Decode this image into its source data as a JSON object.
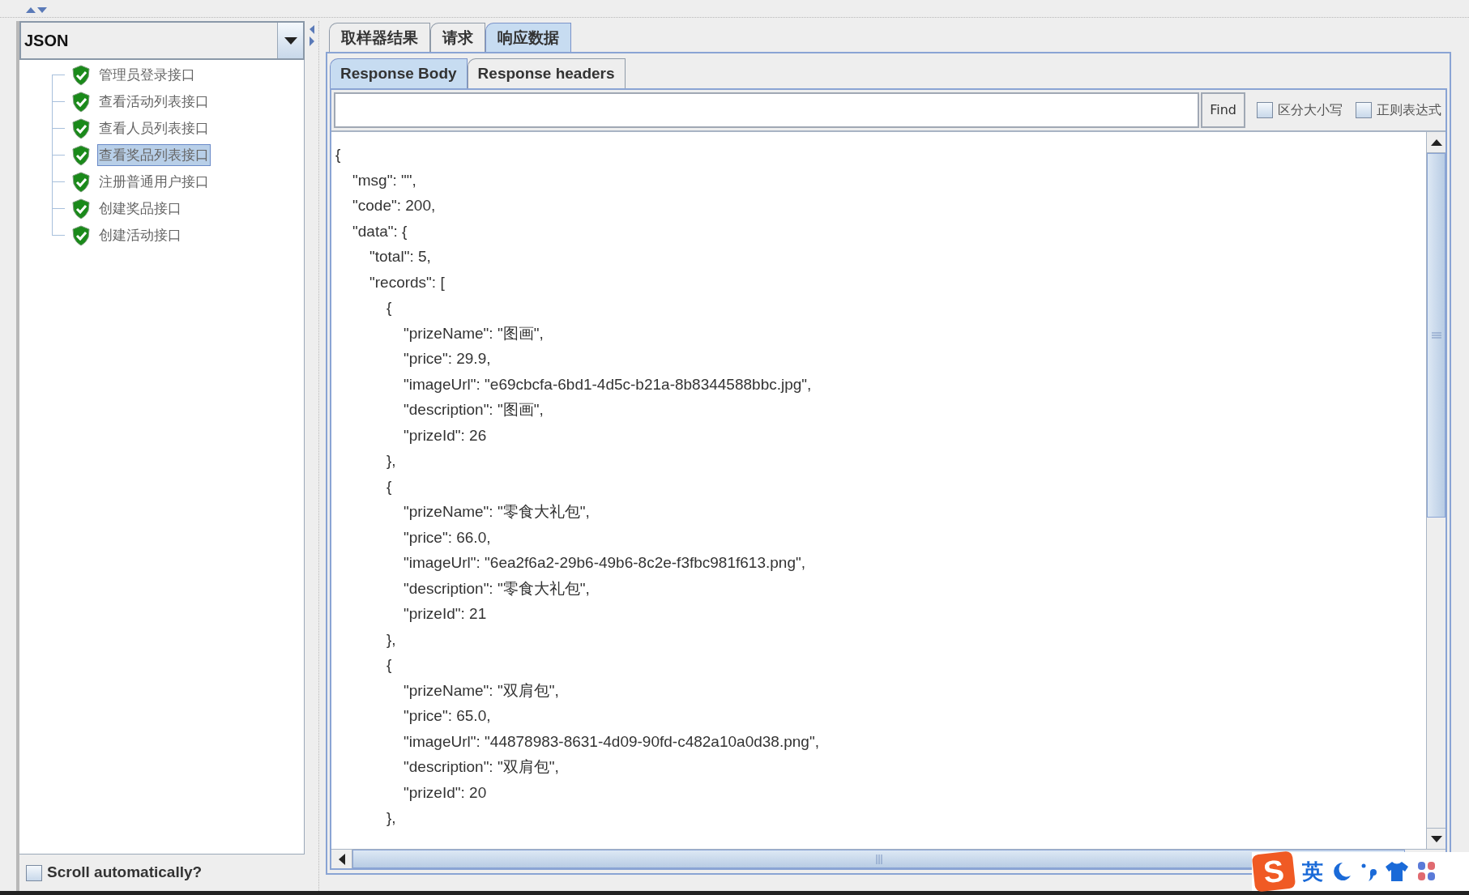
{
  "renderer": {
    "value": "JSON"
  },
  "tree": {
    "items": [
      {
        "label": "管理员登录接口",
        "selected": false
      },
      {
        "label": "查看活动列表接口",
        "selected": false
      },
      {
        "label": "查看人员列表接口",
        "selected": false
      },
      {
        "label": "查看奖品列表接口",
        "selected": true
      },
      {
        "label": "注册普通用户接口",
        "selected": false
      },
      {
        "label": "创建奖品接口",
        "selected": false
      },
      {
        "label": "创建活动接口",
        "selected": false
      }
    ]
  },
  "scroll_automatically": {
    "label": "Scroll automatically?",
    "checked": false
  },
  "tabs": [
    {
      "label": "取样器结果",
      "selected": false
    },
    {
      "label": "请求",
      "selected": false
    },
    {
      "label": "响应数据",
      "selected": true
    }
  ],
  "subtabs": [
    {
      "label": "Response Body",
      "selected": true
    },
    {
      "label": "Response headers",
      "selected": false
    }
  ],
  "find": {
    "button": "Find",
    "options": [
      {
        "label": "区分大小写",
        "checked": false
      },
      {
        "label": "正则表达式",
        "checked": false
      }
    ]
  },
  "body_lines": [
    "{",
    "  \"msg\": \"\",",
    "  \"code\": 200,",
    "  \"data\": {",
    "    \"total\": 5,",
    "    \"records\": [",
    "      {",
    "        \"prizeName\": \"图画\",",
    "        \"price\": 29.9,",
    "        \"imageUrl\": \"e69cbcfa-6bd1-4d5c-b21a-8b8344588bbc.jpg\",",
    "        \"description\": \"图画\",",
    "        \"prizeId\": 26",
    "      },",
    "      {",
    "        \"prizeName\": \"零食大礼包\",",
    "        \"price\": 66.0,",
    "        \"imageUrl\": \"6ea2f6a2-29b6-49b6-8c2e-f3fbc981f613.png\",",
    "        \"description\": \"零食大礼包\",",
    "        \"prizeId\": 21",
    "      },",
    "      {",
    "        \"prizeName\": \"双肩包\",",
    "        \"price\": 65.0,",
    "        \"imageUrl\": \"44878983-8631-4d09-90fd-c482a10a0d38.png\",",
    "        \"description\": \"双肩包\",",
    "        \"prizeId\": 20",
    "      },"
  ],
  "ime": {
    "logo": "S",
    "mode": "英"
  }
}
